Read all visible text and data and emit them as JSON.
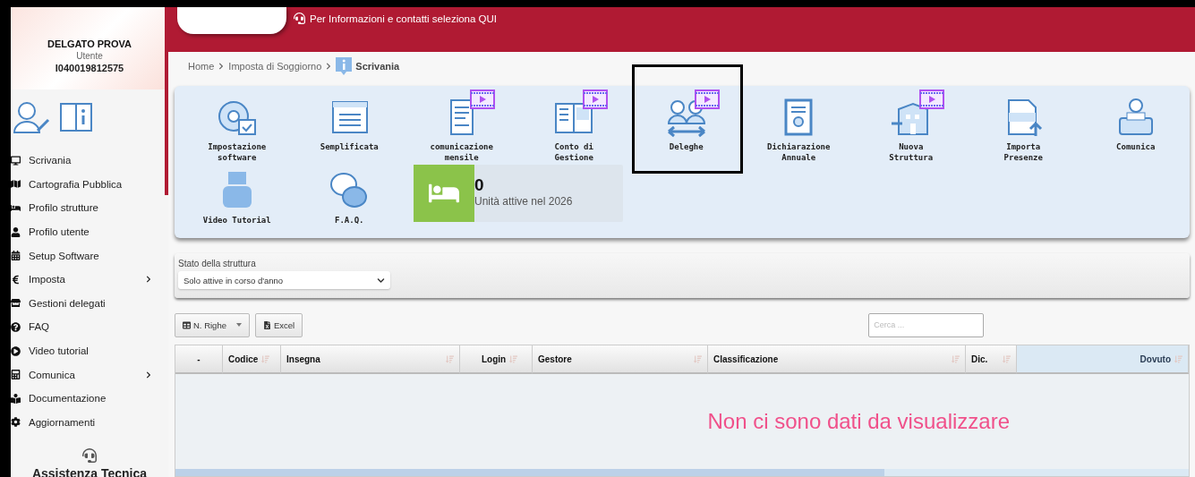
{
  "user": {
    "name": "DELGATO PROVA",
    "role": "Utente",
    "code": "I040019812575"
  },
  "menu": [
    {
      "label": "Scrivania",
      "has_submenu": false
    },
    {
      "label": "Cartografia Pubblica",
      "has_submenu": false
    },
    {
      "label": "Profilo strutture",
      "has_submenu": false
    },
    {
      "label": "Profilo utente",
      "has_submenu": false
    },
    {
      "label": "Setup Software",
      "has_submenu": false
    },
    {
      "label": "Imposta",
      "has_submenu": true
    },
    {
      "label": "Gestioni delegati",
      "has_submenu": false
    },
    {
      "label": "FAQ",
      "has_submenu": false
    },
    {
      "label": "Video tutorial",
      "has_submenu": false
    },
    {
      "label": "Comunica",
      "has_submenu": true
    },
    {
      "label": "Documentazione",
      "has_submenu": false
    },
    {
      "label": "Aggiornamenti",
      "has_submenu": false
    }
  ],
  "support": {
    "label": "Assistenza Tecnica"
  },
  "header": {
    "info_link": "Per Informazioni e contatti seleziona QUI"
  },
  "breadcrumb": [
    {
      "label": "Home"
    },
    {
      "label": "Imposta di Soggiorno"
    },
    {
      "label": "Scrivania"
    }
  ],
  "tiles": [
    {
      "label": "Impostazione software",
      "video": false,
      "highlighted": false
    },
    {
      "label": "Semplificata",
      "video": false,
      "highlighted": false
    },
    {
      "label": "comunicazione mensile",
      "video": true,
      "highlighted": false
    },
    {
      "label": "Conto di Gestione",
      "video": true,
      "highlighted": false
    },
    {
      "label": "Deleghe",
      "video": true,
      "highlighted": true
    },
    {
      "label": "Dichiarazione Annuale",
      "video": false,
      "highlighted": false
    },
    {
      "label": "Nuova Struttura",
      "video": true,
      "highlighted": false
    },
    {
      "label": "Importa Presenze",
      "video": false,
      "highlighted": false
    },
    {
      "label": "Comunica",
      "video": false,
      "highlighted": false
    },
    {
      "label": "Video Tutorial",
      "video": false,
      "highlighted": false
    },
    {
      "label": "F.A.Q.",
      "video": false,
      "highlighted": false
    }
  ],
  "stat": {
    "value": "0",
    "label": "Unità attive nel 2026"
  },
  "filter": {
    "label": "Stato della struttura",
    "value": "Solo attive in corso d'anno"
  },
  "toolbar": {
    "rows_button": "N. Righe",
    "excel_button": "Excel",
    "search_placeholder": "Cerca ..."
  },
  "table": {
    "columns": [
      {
        "label": "-",
        "sortable": false
      },
      {
        "label": "Codice",
        "sortable": true
      },
      {
        "label": "Insegna",
        "sortable": true
      },
      {
        "label": "Login",
        "sortable": true
      },
      {
        "label": "Gestore",
        "sortable": true
      },
      {
        "label": "Classificazione",
        "sortable": true
      },
      {
        "label": "Dic.",
        "sortable": true
      },
      {
        "label": "Dovuto",
        "sortable": true
      }
    ],
    "empty_message": "Non ci sono dati da visualizzare"
  }
}
